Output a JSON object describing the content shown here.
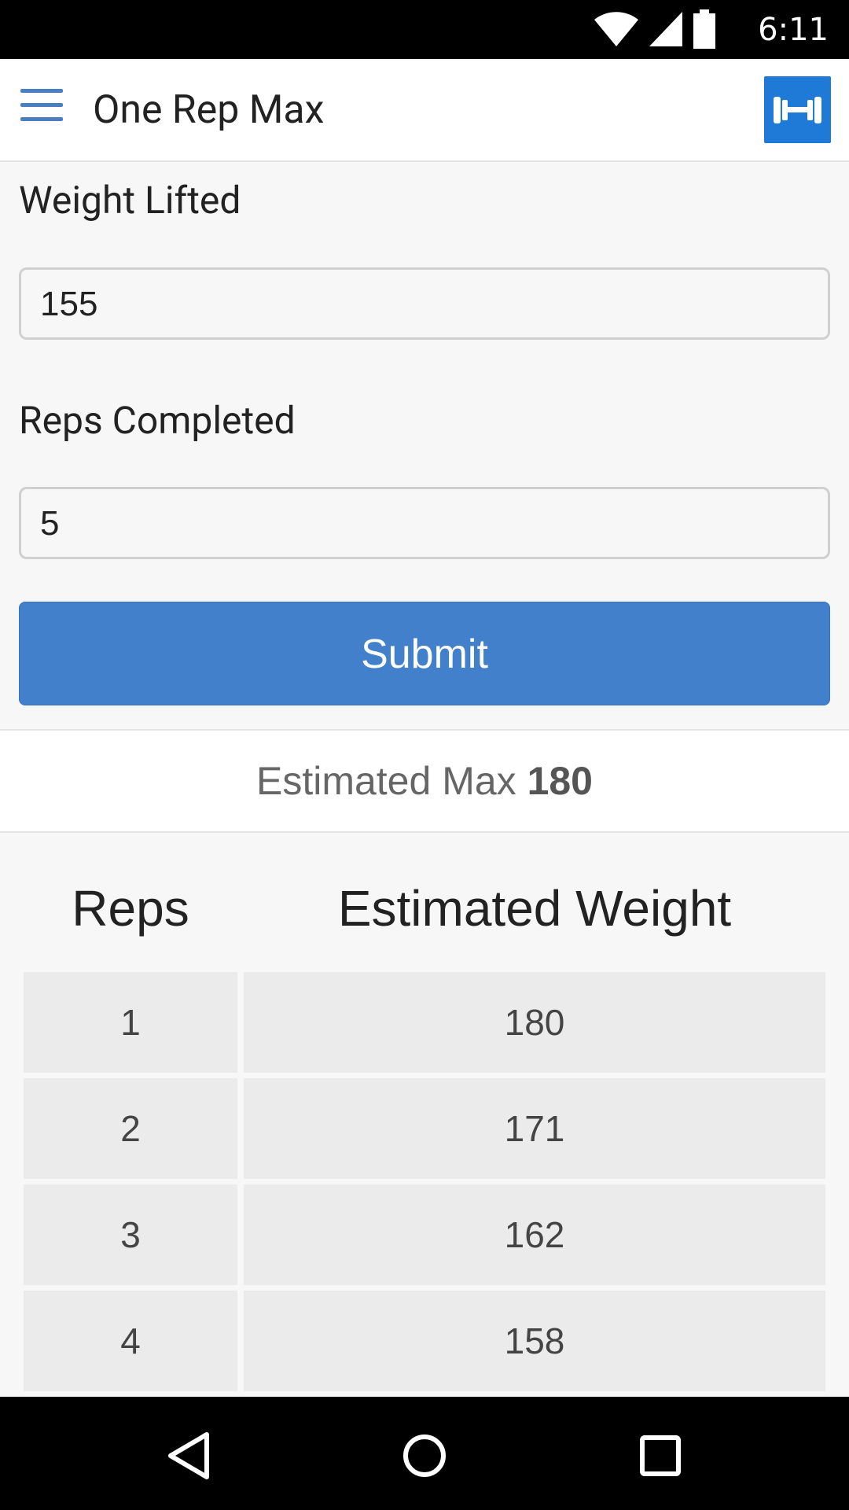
{
  "status_bar": {
    "time": "6:11"
  },
  "app_bar": {
    "title": "One Rep Max",
    "logo_icon": "dumbbell-icon",
    "menu_icon": "hamburger-icon"
  },
  "form": {
    "weight_label": "Weight Lifted",
    "weight_value": "155",
    "reps_label": "Reps Completed",
    "reps_value": "5",
    "submit_label": "Submit"
  },
  "result": {
    "prefix": "Estimated Max",
    "value": "180"
  },
  "table": {
    "headers": [
      "Reps",
      "Estimated Weight"
    ],
    "rows": [
      {
        "reps": "1",
        "weight": "180"
      },
      {
        "reps": "2",
        "weight": "171"
      },
      {
        "reps": "3",
        "weight": "162"
      },
      {
        "reps": "4",
        "weight": "158"
      }
    ]
  },
  "nav_bar": {
    "back_icon": "back-icon",
    "home_icon": "home-icon",
    "recents_icon": "recents-icon"
  },
  "colors": {
    "accent": "#4280cc",
    "logo_bg": "#1e7ad6",
    "menu": "#4a7fc1"
  }
}
